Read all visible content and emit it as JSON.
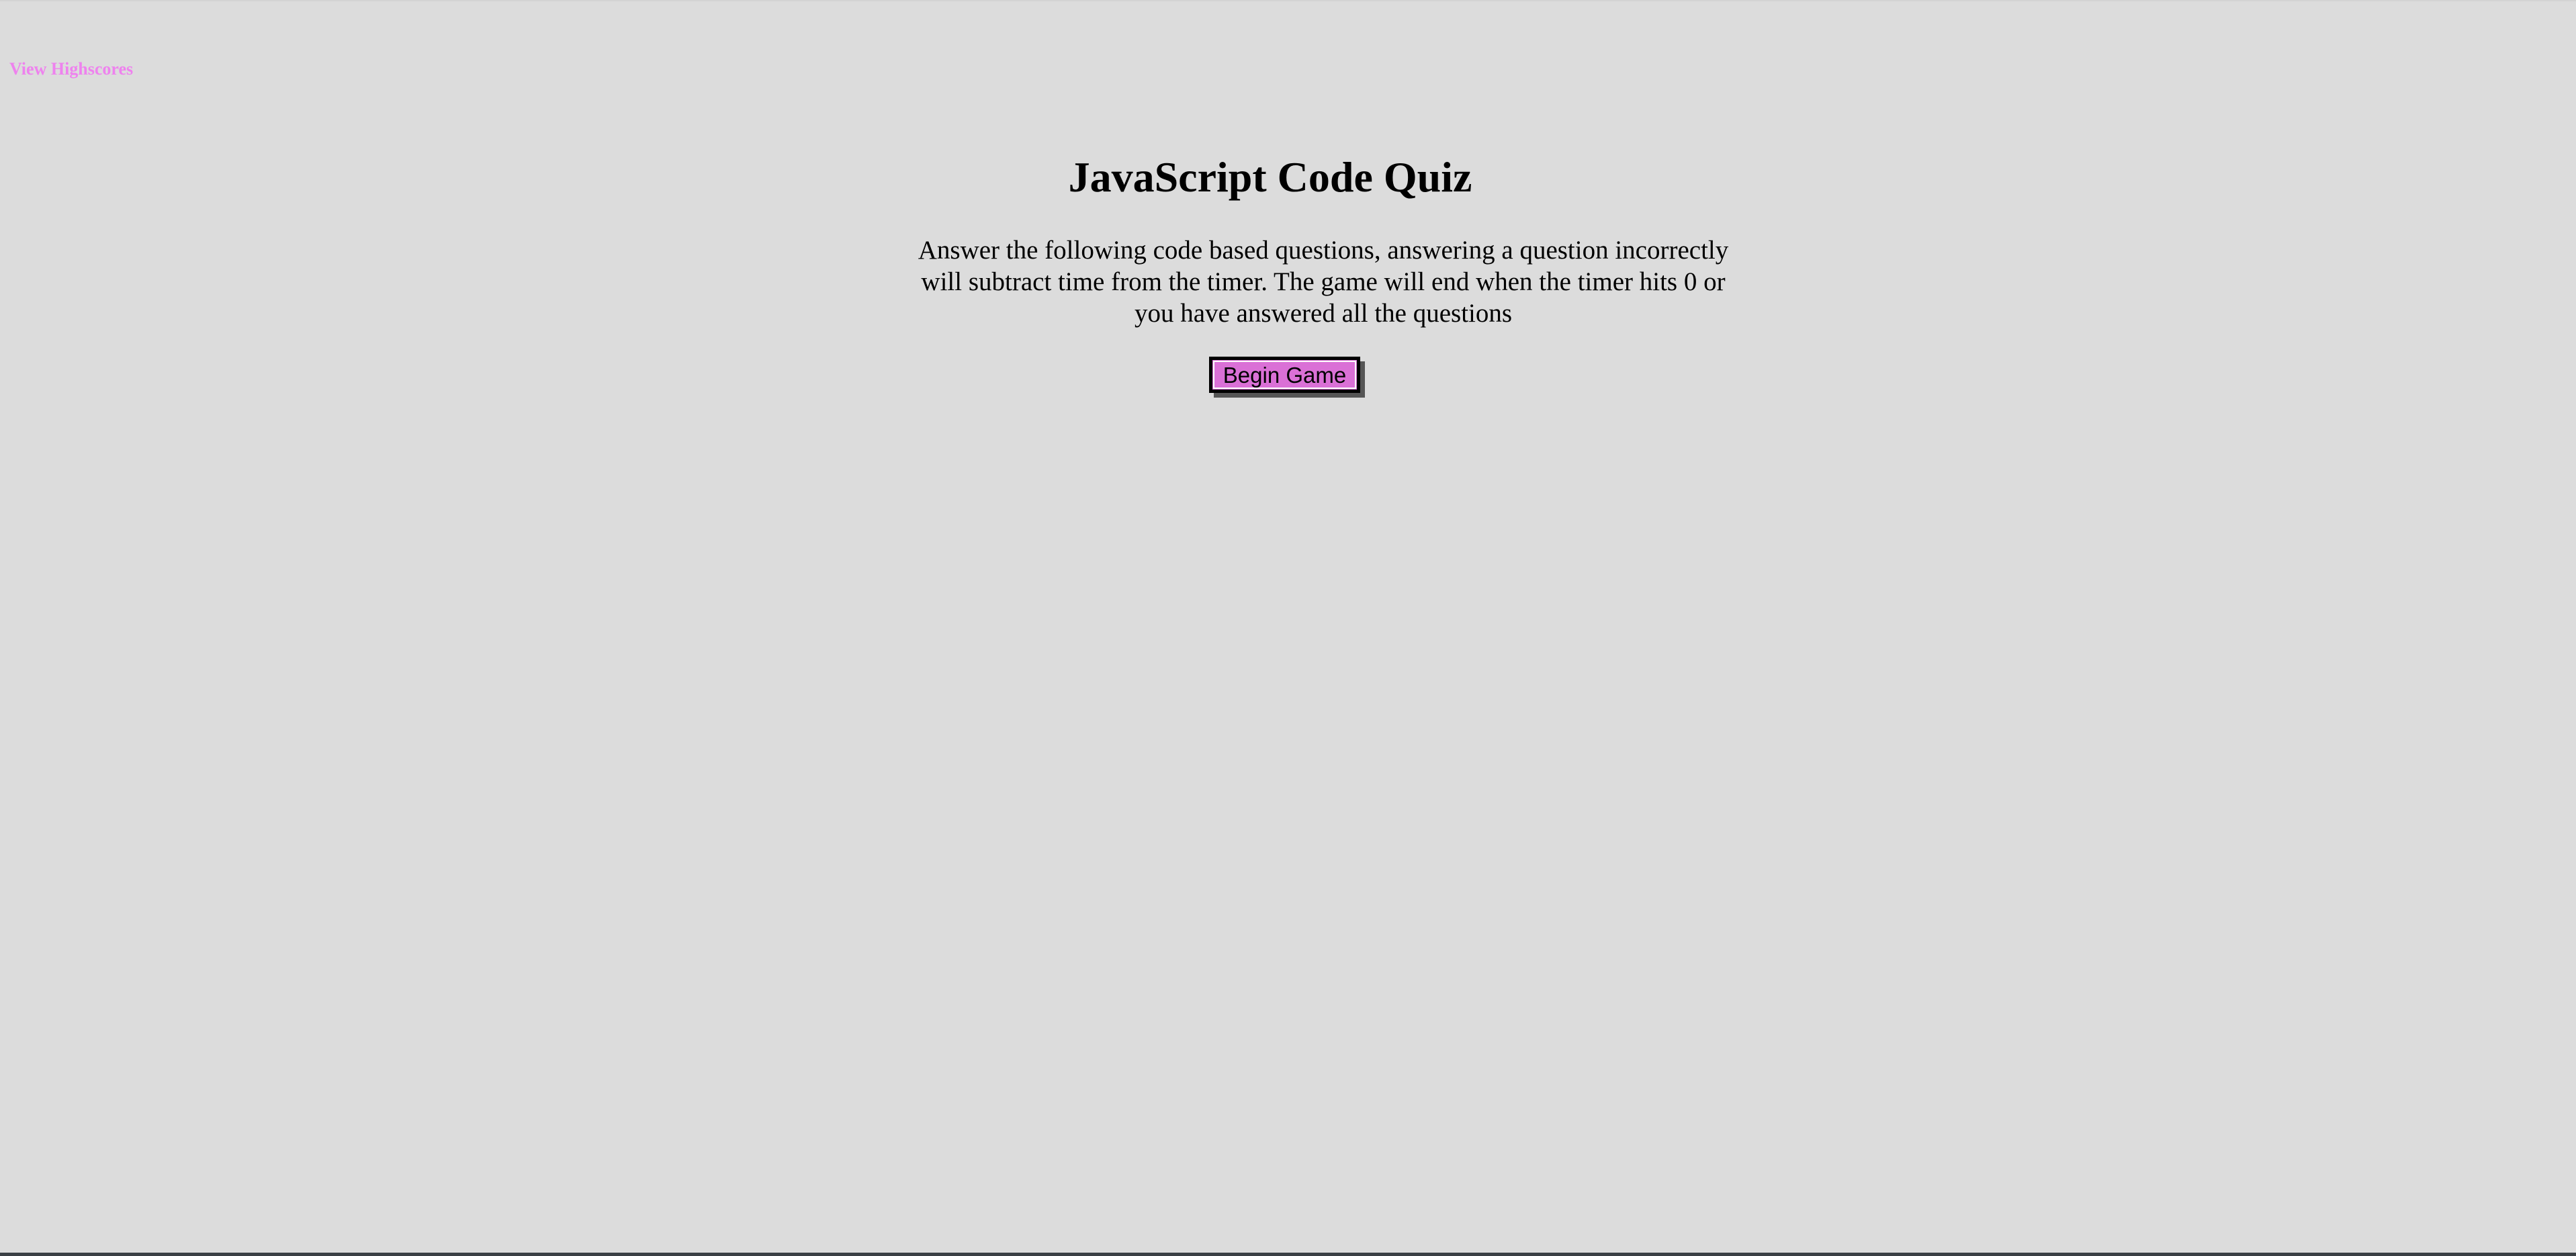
{
  "nav": {
    "highscores_label": "View Highscores"
  },
  "quiz": {
    "title": "JavaScript Code Quiz",
    "description": "Answer the following code based questions, answering a question incorrectly will subtract time from the timer. The game will end when the timer hits 0 or you have answered all the questions",
    "start_button_label": "Begin Game"
  },
  "colors": {
    "background": "#dcdcdc",
    "link": "#ee82ee",
    "button": "#da70d6",
    "text": "#000000"
  }
}
